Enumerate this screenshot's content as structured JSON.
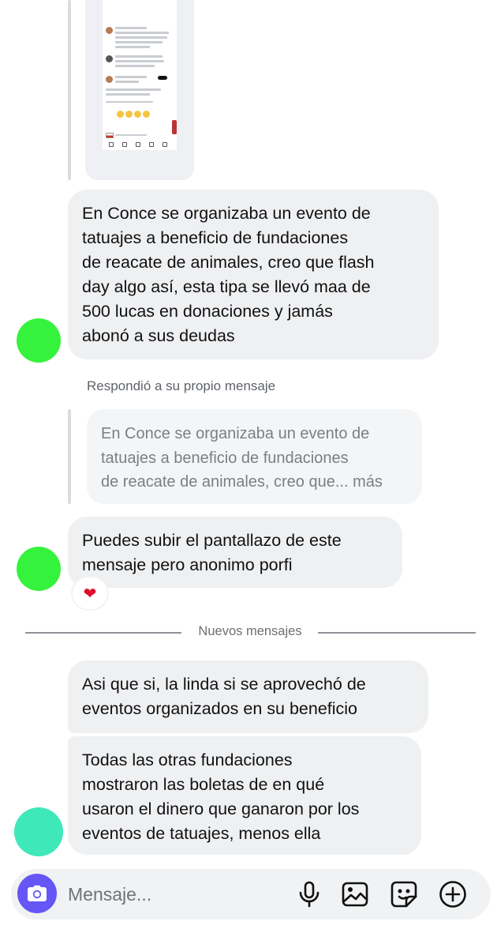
{
  "messages": {
    "m1": "En Conce se organizaba un evento de\ntatuajes a beneficio de fundaciones\nde reacate de animales, creo que flash\nday algo así, esta tipa se llevó maa de\n500 lucas en donaciones y jamás\nabonó a sus deudas",
    "reply_note": "Respondió a su propio mensaje",
    "quoted_text": "En Conce se organizaba un evento de\ntatuajes a beneficio de fundaciones\nde reacate de animales, creo que...",
    "quoted_more": "más",
    "m2": "Puedes subir el pantallazo de este\nmensaje pero anonimo porfi",
    "reaction": "❤",
    "divider": "Nuevos mensajes",
    "m3": "Asi que si, la linda si se aprovechó de\neventos organizados en su beneficio",
    "m4": "Todas las otras fundaciones\nmostraron las boletas de en qué\nusaron el dinero que ganaron por los\neventos de tatuajes, menos ella"
  },
  "composer": {
    "placeholder": "Mensaje..."
  },
  "icons": {
    "camera": "camera-icon",
    "mic": "mic-icon",
    "gallery": "gallery-icon",
    "sticker": "sticker-icon",
    "plus": "plus-icon"
  },
  "colors": {
    "avatar_green": "#35f23c",
    "avatar_teal": "#3ee8b9",
    "camera_button": "#6556f5",
    "bubble": "#eff0f2"
  }
}
